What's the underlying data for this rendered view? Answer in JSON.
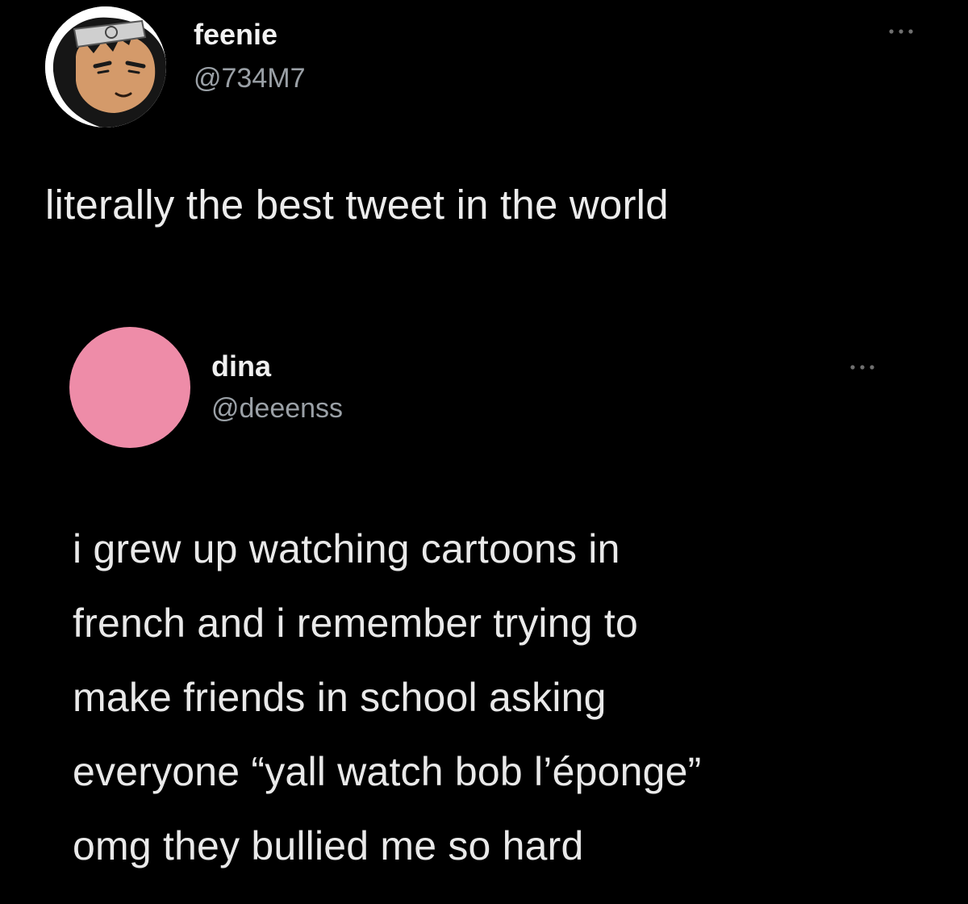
{
  "tweet": {
    "author": {
      "name": "feenie",
      "handle": "@734M7",
      "avatar_icon": "anime-character-avatar"
    },
    "more_icon": "more-options-icon",
    "text": "literally the best tweet in the world"
  },
  "quoted_tweet": {
    "author": {
      "name": "dina",
      "handle": "@deeenss",
      "avatar_color": "#ee8ca8"
    },
    "more_icon": "more-options-icon",
    "lines": [
      "i grew up watching cartoons in",
      "french and i remember trying to",
      "make friends in school asking",
      "everyone “yall watch bob l’éponge”",
      "omg they bullied me so hard"
    ]
  },
  "colors": {
    "background": "#000000",
    "text": "#ececec",
    "handle": "#9aa0a6"
  }
}
